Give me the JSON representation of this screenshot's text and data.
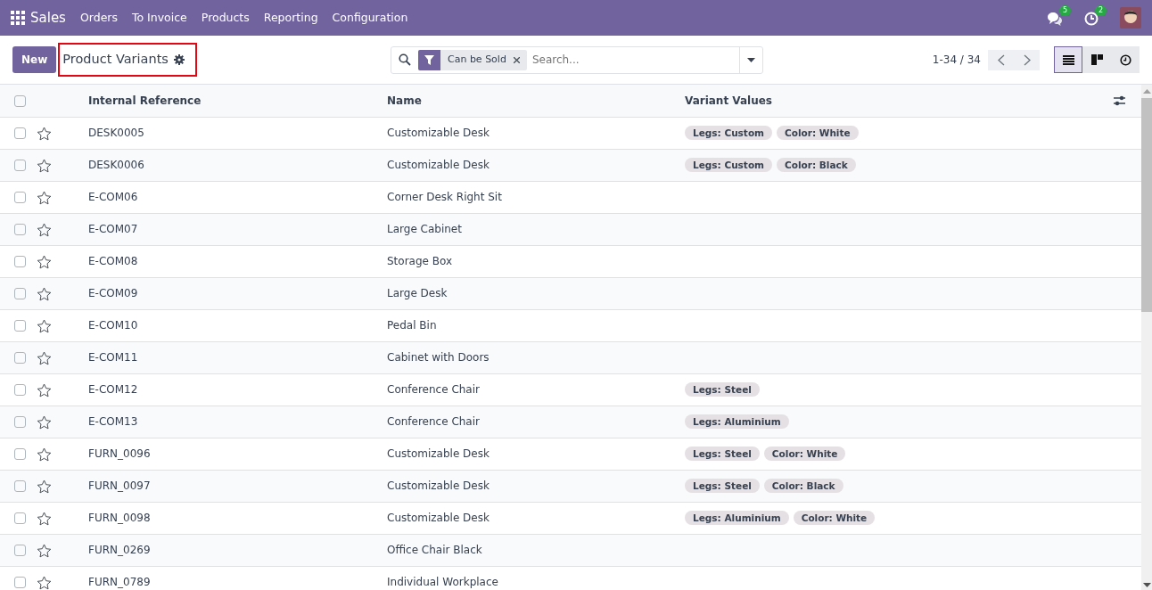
{
  "navbar": {
    "app": "Sales",
    "menu": [
      "Orders",
      "To Invoice",
      "Products",
      "Reporting",
      "Configuration"
    ],
    "messages_count": "5",
    "activities_count": "2"
  },
  "control_panel": {
    "new_button": "New",
    "title": "Product Variants",
    "title_highlighted": true,
    "facets": [
      {
        "label": "Can be Sold"
      }
    ],
    "search_placeholder": "Search...",
    "pager": "1-34 / 34",
    "views": [
      {
        "kind": "list",
        "selected": true
      },
      {
        "kind": "kanban",
        "selected": false
      },
      {
        "kind": "activity",
        "selected": false
      }
    ]
  },
  "table": {
    "columns": [
      "Internal Reference",
      "Name",
      "Variant Values"
    ],
    "all_checked": false,
    "rows": [
      {
        "ref": "DESK0005",
        "name": "Customizable Desk",
        "values": [
          "Legs: Custom",
          "Color: White"
        ],
        "checked": false,
        "starred": false
      },
      {
        "ref": "DESK0006",
        "name": "Customizable Desk",
        "values": [
          "Legs: Custom",
          "Color: Black"
        ],
        "checked": false,
        "starred": false
      },
      {
        "ref": "E-COM06",
        "name": "Corner Desk Right Sit",
        "values": [],
        "checked": false,
        "starred": false
      },
      {
        "ref": "E-COM07",
        "name": "Large Cabinet",
        "values": [],
        "checked": false,
        "starred": false
      },
      {
        "ref": "E-COM08",
        "name": "Storage Box",
        "values": [],
        "checked": false,
        "starred": false
      },
      {
        "ref": "E-COM09",
        "name": "Large Desk",
        "values": [],
        "checked": false,
        "starred": false
      },
      {
        "ref": "E-COM10",
        "name": "Pedal Bin",
        "values": [],
        "checked": false,
        "starred": false
      },
      {
        "ref": "E-COM11",
        "name": "Cabinet with Doors",
        "values": [],
        "checked": false,
        "starred": false
      },
      {
        "ref": "E-COM12",
        "name": "Conference Chair",
        "values": [
          "Legs: Steel"
        ],
        "checked": false,
        "starred": false
      },
      {
        "ref": "E-COM13",
        "name": "Conference Chair",
        "values": [
          "Legs: Aluminium"
        ],
        "checked": false,
        "starred": false
      },
      {
        "ref": "FURN_0096",
        "name": "Customizable Desk",
        "values": [
          "Legs: Steel",
          "Color: White"
        ],
        "checked": false,
        "starred": false
      },
      {
        "ref": "FURN_0097",
        "name": "Customizable Desk",
        "values": [
          "Legs: Steel",
          "Color: Black"
        ],
        "checked": false,
        "starred": false
      },
      {
        "ref": "FURN_0098",
        "name": "Customizable Desk",
        "values": [
          "Legs: Aluminium",
          "Color: White"
        ],
        "checked": false,
        "starred": false
      },
      {
        "ref": "FURN_0269",
        "name": "Office Chair Black",
        "values": [],
        "checked": false,
        "starred": false
      },
      {
        "ref": "FURN_0789",
        "name": "Individual Workplace",
        "values": [],
        "checked": false,
        "starred": false
      }
    ]
  }
}
